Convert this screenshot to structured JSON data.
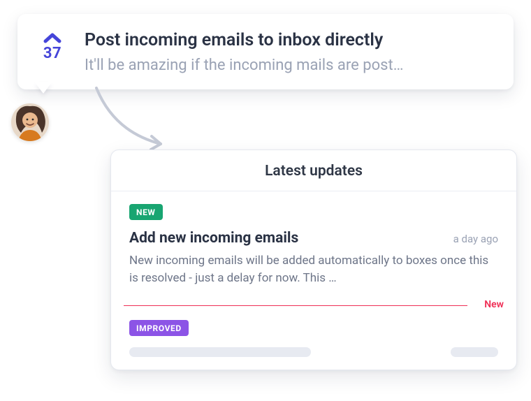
{
  "request": {
    "vote_count": "37",
    "title": "Post incoming emails to inbox directly",
    "description": "It'll be amazing if the incoming mails are post…"
  },
  "updates_panel": {
    "header": "Latest updates",
    "divider_label": "New",
    "items": [
      {
        "badge": "NEW",
        "badge_kind": "new",
        "title": "Add new incoming emails",
        "time": "a day ago",
        "body": "New incoming emails will be added automatically to boxes once this is resolved - just a delay for now.  This …"
      },
      {
        "badge": "IMPROVED",
        "badge_kind": "improved"
      }
    ]
  },
  "colors": {
    "vote": "#4545d9",
    "badge_new": "#18a571",
    "badge_improved": "#8c54e6",
    "divider": "#ef2e55"
  }
}
